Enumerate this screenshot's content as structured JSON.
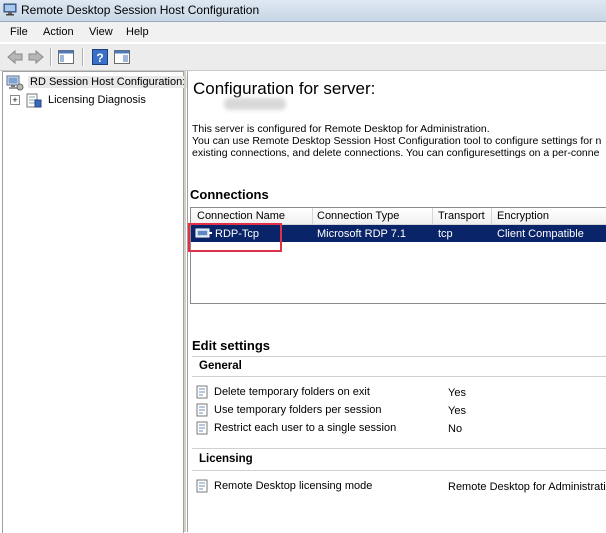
{
  "window": {
    "title": "Remote Desktop Session Host Configuration"
  },
  "menu": [
    "File",
    "Action",
    "View",
    "Help"
  ],
  "tree": {
    "root_label": "RD Session Host Configuration:",
    "child_label": "Licensing Diagnosis",
    "child_expander": "+"
  },
  "main": {
    "title": "Configuration for server:",
    "description_line1": "This server is configured for Remote Desktop for Administration.",
    "description_line2": "You can use Remote Desktop Session Host Configuration tool to configure settings for n",
    "description_line3": "existing connections, and delete connections. You can configuresettings on a per-conne",
    "connections_heading": "Connections",
    "columns": [
      "Connection Name",
      "Connection Type",
      "Transport",
      "Encryption"
    ],
    "rows": [
      {
        "name": "RDP-Tcp",
        "type": "Microsoft RDP 7.1",
        "transport": "tcp",
        "encryption": "Client Compatible"
      }
    ],
    "edit_heading": "Edit settings",
    "general_heading": "General",
    "general_settings": [
      {
        "label": "Delete temporary folders on exit",
        "value": "Yes"
      },
      {
        "label": "Use temporary folders per session",
        "value": "Yes"
      },
      {
        "label": "Restrict each user to a single session",
        "value": "No"
      }
    ],
    "licensing_heading": "Licensing",
    "licensing_settings": [
      {
        "label": "Remote Desktop licensing mode",
        "value": "Remote Desktop for Administration"
      }
    ]
  },
  "colors": {
    "selection": "#0a246a",
    "highlight_box": "#e0304a"
  }
}
